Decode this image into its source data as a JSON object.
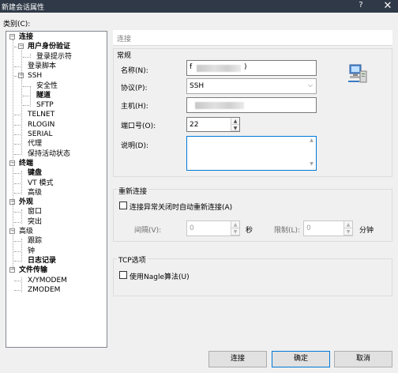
{
  "window": {
    "title": "新建会话属性",
    "help_label": "?",
    "close_label": "✕"
  },
  "category_label": "类别(C):",
  "tree": [
    {
      "label": "连接",
      "bold": true,
      "level": 0,
      "toggle": "−"
    },
    {
      "label": "用户身份验证",
      "bold": true,
      "level": 1,
      "toggle": "−"
    },
    {
      "label": "登录提示符",
      "bold": false,
      "level": 2
    },
    {
      "label": "登录脚本",
      "bold": false,
      "level": 1
    },
    {
      "label": "SSH",
      "bold": false,
      "level": 1,
      "toggle": "−"
    },
    {
      "label": "安全性",
      "bold": false,
      "level": 2
    },
    {
      "label": "隧道",
      "bold": true,
      "level": 2
    },
    {
      "label": "SFTP",
      "bold": false,
      "level": 2
    },
    {
      "label": "TELNET",
      "bold": false,
      "level": 1
    },
    {
      "label": "RLOGIN",
      "bold": false,
      "level": 1
    },
    {
      "label": "SERIAL",
      "bold": false,
      "level": 1
    },
    {
      "label": "代理",
      "bold": false,
      "level": 1
    },
    {
      "label": "保持活动状态",
      "bold": false,
      "level": 1
    },
    {
      "label": "终端",
      "bold": true,
      "level": 0,
      "toggle": "−"
    },
    {
      "label": "键盘",
      "bold": true,
      "level": 1
    },
    {
      "label": "VT 模式",
      "bold": false,
      "level": 1
    },
    {
      "label": "高级",
      "bold": false,
      "level": 1
    },
    {
      "label": "外观",
      "bold": true,
      "level": 0,
      "toggle": "−"
    },
    {
      "label": "窗口",
      "bold": false,
      "level": 1
    },
    {
      "label": "突出",
      "bold": false,
      "level": 1
    },
    {
      "label": "高级",
      "bold": false,
      "level": 0,
      "toggle": "−"
    },
    {
      "label": "跟踪",
      "bold": false,
      "level": 1
    },
    {
      "label": "钟",
      "bold": false,
      "level": 1
    },
    {
      "label": "日志记录",
      "bold": true,
      "level": 1
    },
    {
      "label": "文件传输",
      "bold": true,
      "level": 0,
      "toggle": "−"
    },
    {
      "label": "X/YMODEM",
      "bold": false,
      "level": 1
    },
    {
      "label": "ZMODEM",
      "bold": false,
      "level": 1
    }
  ],
  "panel": {
    "header": "连接"
  },
  "general": {
    "title": "常规",
    "name_label": "名称(N):",
    "name_value_suffix": ")",
    "name_value_prefix": "f",
    "protocol_label": "协议(P):",
    "protocol_value": "SSH",
    "host_label": "主机(H):",
    "port_label": "端口号(O):",
    "port_value": "22",
    "desc_label": "说明(D):",
    "icon": "network-computer-icon"
  },
  "reconnect": {
    "title": "重新连接",
    "auto_label": "连接异常关闭时自动重新连接(A)",
    "interval_label": "间隔(V):",
    "interval_value": "0",
    "interval_unit": "秒",
    "limit_label": "限制(L):",
    "limit_value": "0",
    "limit_unit": "分钟"
  },
  "tcp": {
    "title": "TCP选项",
    "nagle_label": "使用Nagle算法(U)"
  },
  "buttons": {
    "connect": "连接",
    "ok": "确定",
    "cancel": "取消"
  }
}
